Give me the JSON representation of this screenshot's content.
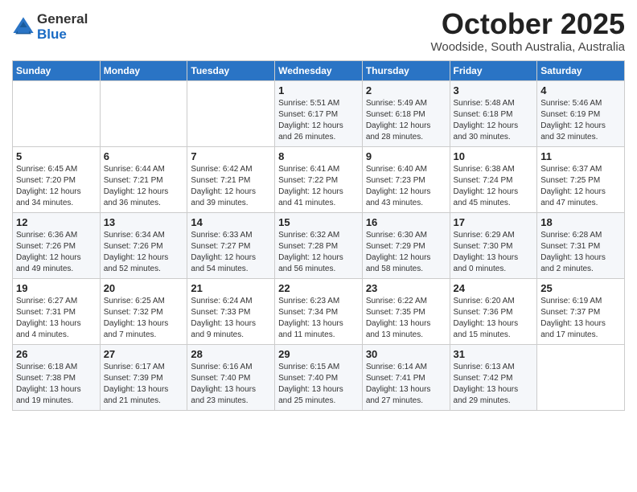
{
  "logo": {
    "general": "General",
    "blue": "Blue"
  },
  "title": "October 2025",
  "location": "Woodside, South Australia, Australia",
  "days_of_week": [
    "Sunday",
    "Monday",
    "Tuesday",
    "Wednesday",
    "Thursday",
    "Friday",
    "Saturday"
  ],
  "weeks": [
    [
      {
        "day": "",
        "content": ""
      },
      {
        "day": "",
        "content": ""
      },
      {
        "day": "",
        "content": ""
      },
      {
        "day": "1",
        "content": "Sunrise: 5:51 AM\nSunset: 6:17 PM\nDaylight: 12 hours\nand 26 minutes."
      },
      {
        "day": "2",
        "content": "Sunrise: 5:49 AM\nSunset: 6:18 PM\nDaylight: 12 hours\nand 28 minutes."
      },
      {
        "day": "3",
        "content": "Sunrise: 5:48 AM\nSunset: 6:18 PM\nDaylight: 12 hours\nand 30 minutes."
      },
      {
        "day": "4",
        "content": "Sunrise: 5:46 AM\nSunset: 6:19 PM\nDaylight: 12 hours\nand 32 minutes."
      }
    ],
    [
      {
        "day": "5",
        "content": "Sunrise: 6:45 AM\nSunset: 7:20 PM\nDaylight: 12 hours\nand 34 minutes."
      },
      {
        "day": "6",
        "content": "Sunrise: 6:44 AM\nSunset: 7:21 PM\nDaylight: 12 hours\nand 36 minutes."
      },
      {
        "day": "7",
        "content": "Sunrise: 6:42 AM\nSunset: 7:21 PM\nDaylight: 12 hours\nand 39 minutes."
      },
      {
        "day": "8",
        "content": "Sunrise: 6:41 AM\nSunset: 7:22 PM\nDaylight: 12 hours\nand 41 minutes."
      },
      {
        "day": "9",
        "content": "Sunrise: 6:40 AM\nSunset: 7:23 PM\nDaylight: 12 hours\nand 43 minutes."
      },
      {
        "day": "10",
        "content": "Sunrise: 6:38 AM\nSunset: 7:24 PM\nDaylight: 12 hours\nand 45 minutes."
      },
      {
        "day": "11",
        "content": "Sunrise: 6:37 AM\nSunset: 7:25 PM\nDaylight: 12 hours\nand 47 minutes."
      }
    ],
    [
      {
        "day": "12",
        "content": "Sunrise: 6:36 AM\nSunset: 7:26 PM\nDaylight: 12 hours\nand 49 minutes."
      },
      {
        "day": "13",
        "content": "Sunrise: 6:34 AM\nSunset: 7:26 PM\nDaylight: 12 hours\nand 52 minutes."
      },
      {
        "day": "14",
        "content": "Sunrise: 6:33 AM\nSunset: 7:27 PM\nDaylight: 12 hours\nand 54 minutes."
      },
      {
        "day": "15",
        "content": "Sunrise: 6:32 AM\nSunset: 7:28 PM\nDaylight: 12 hours\nand 56 minutes."
      },
      {
        "day": "16",
        "content": "Sunrise: 6:30 AM\nSunset: 7:29 PM\nDaylight: 12 hours\nand 58 minutes."
      },
      {
        "day": "17",
        "content": "Sunrise: 6:29 AM\nSunset: 7:30 PM\nDaylight: 13 hours\nand 0 minutes."
      },
      {
        "day": "18",
        "content": "Sunrise: 6:28 AM\nSunset: 7:31 PM\nDaylight: 13 hours\nand 2 minutes."
      }
    ],
    [
      {
        "day": "19",
        "content": "Sunrise: 6:27 AM\nSunset: 7:31 PM\nDaylight: 13 hours\nand 4 minutes."
      },
      {
        "day": "20",
        "content": "Sunrise: 6:25 AM\nSunset: 7:32 PM\nDaylight: 13 hours\nand 7 minutes."
      },
      {
        "day": "21",
        "content": "Sunrise: 6:24 AM\nSunset: 7:33 PM\nDaylight: 13 hours\nand 9 minutes."
      },
      {
        "day": "22",
        "content": "Sunrise: 6:23 AM\nSunset: 7:34 PM\nDaylight: 13 hours\nand 11 minutes."
      },
      {
        "day": "23",
        "content": "Sunrise: 6:22 AM\nSunset: 7:35 PM\nDaylight: 13 hours\nand 13 minutes."
      },
      {
        "day": "24",
        "content": "Sunrise: 6:20 AM\nSunset: 7:36 PM\nDaylight: 13 hours\nand 15 minutes."
      },
      {
        "day": "25",
        "content": "Sunrise: 6:19 AM\nSunset: 7:37 PM\nDaylight: 13 hours\nand 17 minutes."
      }
    ],
    [
      {
        "day": "26",
        "content": "Sunrise: 6:18 AM\nSunset: 7:38 PM\nDaylight: 13 hours\nand 19 minutes."
      },
      {
        "day": "27",
        "content": "Sunrise: 6:17 AM\nSunset: 7:39 PM\nDaylight: 13 hours\nand 21 minutes."
      },
      {
        "day": "28",
        "content": "Sunrise: 6:16 AM\nSunset: 7:40 PM\nDaylight: 13 hours\nand 23 minutes."
      },
      {
        "day": "29",
        "content": "Sunrise: 6:15 AM\nSunset: 7:40 PM\nDaylight: 13 hours\nand 25 minutes."
      },
      {
        "day": "30",
        "content": "Sunrise: 6:14 AM\nSunset: 7:41 PM\nDaylight: 13 hours\nand 27 minutes."
      },
      {
        "day": "31",
        "content": "Sunrise: 6:13 AM\nSunset: 7:42 PM\nDaylight: 13 hours\nand 29 minutes."
      },
      {
        "day": "",
        "content": ""
      }
    ]
  ]
}
